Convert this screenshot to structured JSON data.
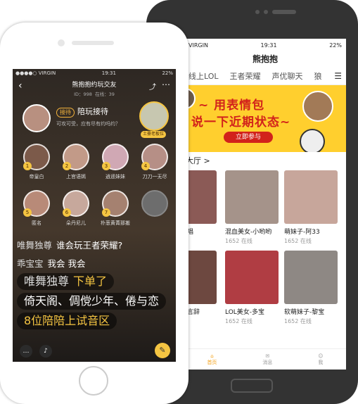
{
  "back_phone": {
    "status": {
      "carrier": "VIRGIN",
      "time": "19:31",
      "battery": "22%"
    },
    "app_title": "熊抱抱",
    "tabs": [
      "线上LOL",
      "王者荣耀",
      "声优聊天",
      "狼"
    ],
    "banner": {
      "line1": "~ 用表情包",
      "line2": "说一下近期状态~",
      "button": "立即参与"
    },
    "section_title": "大厅 >",
    "cards": [
      {
        "name": "唱",
        "online": ""
      },
      {
        "name": "混血美女-小哟哟",
        "online": "1652 在线"
      },
      {
        "name": "萌妹子-阿33",
        "online": "1652 在线"
      },
      {
        "name": "言辞",
        "online": ""
      },
      {
        "name": "LOL美女-多宝",
        "online": "1652 在线"
      },
      {
        "name": "软萌妹子-黎宝",
        "online": "1652 在线"
      }
    ],
    "nav": [
      "首页",
      "消息",
      "我"
    ]
  },
  "front_phone": {
    "status": {
      "carrier": "●●●●○ VIRGIN",
      "time": "19:31",
      "battery": "22%"
    },
    "room_title": "熊抱抱约玩交友",
    "room_id": "ID：998",
    "online": "在线：39",
    "host": {
      "tag": "接待",
      "role": "陪玩接待",
      "line": "可攻可受，应有尽有约吗约？",
      "boss_badge": "土豪老板位"
    },
    "seats": [
      {
        "num": "1",
        "name": "帝皇白"
      },
      {
        "num": "2",
        "name": "上官语嫣"
      },
      {
        "num": "3",
        "name": "逍遥妹妹"
      },
      {
        "num": "4",
        "name": "刀刀一无尽"
      },
      {
        "num": "5",
        "name": "匿名"
      },
      {
        "num": "6",
        "name": "朵丹尼儿"
      },
      {
        "num": "7",
        "name": "朴葱黄菁那搬"
      }
    ],
    "chat": [
      {
        "user": "唯舞独尊",
        "text": "谁会玩王者荣耀?"
      },
      {
        "user": "乖宝宝",
        "text": "我会 我会"
      },
      {
        "user": "唯舞独尊",
        "text": "下单了"
      },
      {
        "user": "",
        "text": "倚天阁、倜傥少年、倦与恋"
      },
      {
        "user": "",
        "text": "8位陪陪上试音区"
      }
    ]
  },
  "colors": {
    "accent": "#f5c542",
    "banner_red": "#d2221b",
    "banner_bg": "#ffcf2e"
  }
}
